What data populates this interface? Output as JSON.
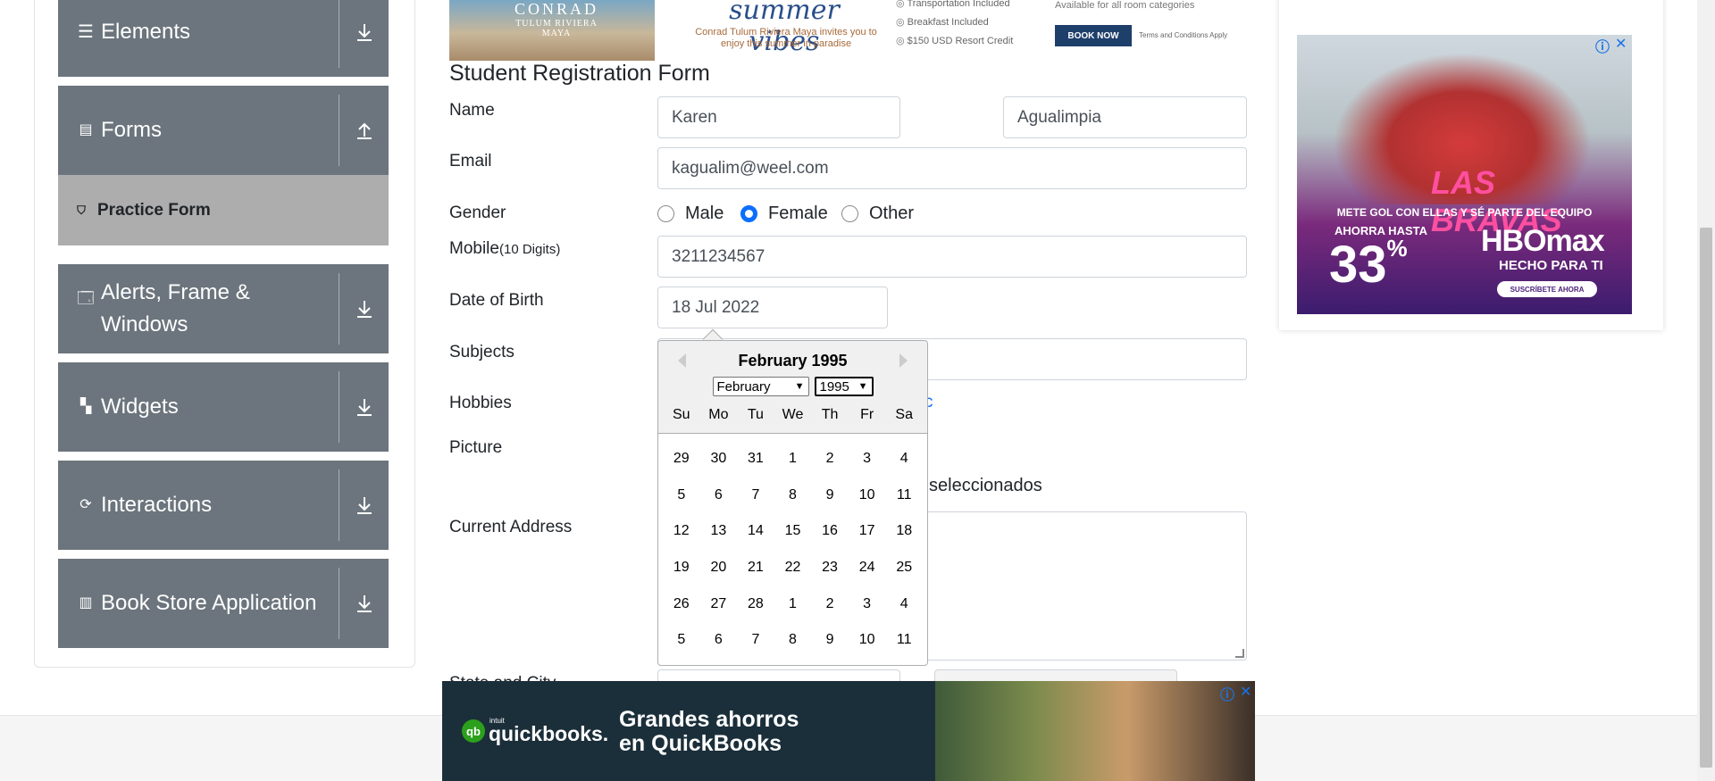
{
  "sidebar": {
    "groups": [
      {
        "label": "Elements",
        "icon": "hamburger-icon",
        "toggle": "download-icon"
      },
      {
        "label": "Forms",
        "icon": "document-icon",
        "toggle": "upload-icon"
      },
      {
        "label": "Alerts, Frame & Windows",
        "icon": "window-icon",
        "toggle": "download-icon"
      },
      {
        "label": "Widgets",
        "icon": "widgets-icon",
        "toggle": "download-icon"
      },
      {
        "label": "Interactions",
        "icon": "interactions-icon",
        "toggle": "download-icon"
      },
      {
        "label": "Book Store Application",
        "icon": "books-icon",
        "toggle": "download-icon"
      }
    ],
    "active_item": "Practice Form"
  },
  "top_ad": {
    "brand": "CONRAD",
    "location": "TULUM RIVIERA MAYA",
    "tagline": "summer vibes",
    "invite": "Conrad Tulum Riviera Maya invites you to enjoy this summer in paradise",
    "perks": [
      "Transportation Included",
      "Breakfast Included",
      "$150 USD Resort Credit"
    ],
    "availability": "Available for all room categories",
    "cta": "BOOK NOW",
    "terms": "Terms and Conditions Apply"
  },
  "form": {
    "title": "Student Registration Form",
    "labels": {
      "name": "Name",
      "email": "Email",
      "gender": "Gender",
      "mobile": "Mobile",
      "mobile_hint": "(10 Digits)",
      "dob": "Date of Birth",
      "subjects": "Subjects",
      "hobbies": "Hobbies",
      "picture": "Picture",
      "address": "Current Address",
      "state_city": "State and City"
    },
    "first_name": "Karen",
    "last_name": "Agualimpia",
    "email": "kagualim@weel.com",
    "gender_options": [
      "Male",
      "Female",
      "Other"
    ],
    "gender_selected": "Female",
    "mobile": "3211234567",
    "dob": "18 Jul 2022",
    "hobbies_partial": "c",
    "file_status": "seleccionados"
  },
  "datepicker": {
    "title": "February 1995",
    "month_select": "February",
    "year_select": "1995",
    "weekdays": [
      "Su",
      "Mo",
      "Tu",
      "We",
      "Th",
      "Fr",
      "Sa"
    ],
    "weeks": [
      [
        "29",
        "30",
        "31",
        "1",
        "2",
        "3",
        "4"
      ],
      [
        "5",
        "6",
        "7",
        "8",
        "9",
        "10",
        "11"
      ],
      [
        "12",
        "13",
        "14",
        "15",
        "16",
        "17",
        "18"
      ],
      [
        "19",
        "20",
        "21",
        "22",
        "23",
        "24",
        "25"
      ],
      [
        "26",
        "27",
        "28",
        "1",
        "2",
        "3",
        "4"
      ],
      [
        "5",
        "6",
        "7",
        "8",
        "9",
        "10",
        "11"
      ]
    ]
  },
  "right_ad": {
    "show_name": "LAS BRAVAS",
    "tagline": "METE GOL CON ELLAS Y SÉ PARTE DEL EQUIPO",
    "discount_prefix": "AHORRA HASTA",
    "discount": "33",
    "discount_unit": "%",
    "brand": "HBOmax",
    "slogan": "HECHO PARA TI",
    "cta": "SUSCRÍBETE AHORA"
  },
  "bottom_ad": {
    "brand_prefix": "intuit",
    "brand": "quickbooks.",
    "headline_line1": "Grandes ahorros",
    "headline_line2": "en QuickBooks"
  },
  "ad_controls": {
    "info": "ⓘ",
    "close": "✕"
  }
}
